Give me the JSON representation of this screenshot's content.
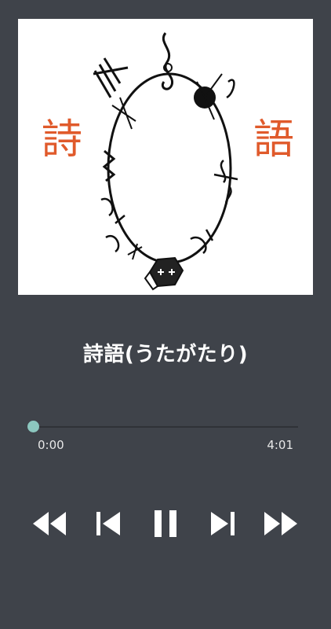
{
  "artwork": {
    "kanji_left": "詩",
    "kanji_right": "語"
  },
  "track": {
    "title": "詩語(うたがたり)"
  },
  "playback": {
    "elapsed": "0:00",
    "duration": "4:01",
    "progress": 0.0,
    "state": "playing"
  },
  "colors": {
    "background": "#3f434a",
    "accent": "#8cc7bf",
    "kanji": "#e05a2b"
  },
  "controls": [
    {
      "name": "rewind-button",
      "icon": "rewind-icon"
    },
    {
      "name": "previous-button",
      "icon": "skip-previous-icon"
    },
    {
      "name": "pause-button",
      "icon": "pause-icon"
    },
    {
      "name": "next-button",
      "icon": "skip-next-icon"
    },
    {
      "name": "fast-forward-button",
      "icon": "fast-forward-icon"
    }
  ]
}
